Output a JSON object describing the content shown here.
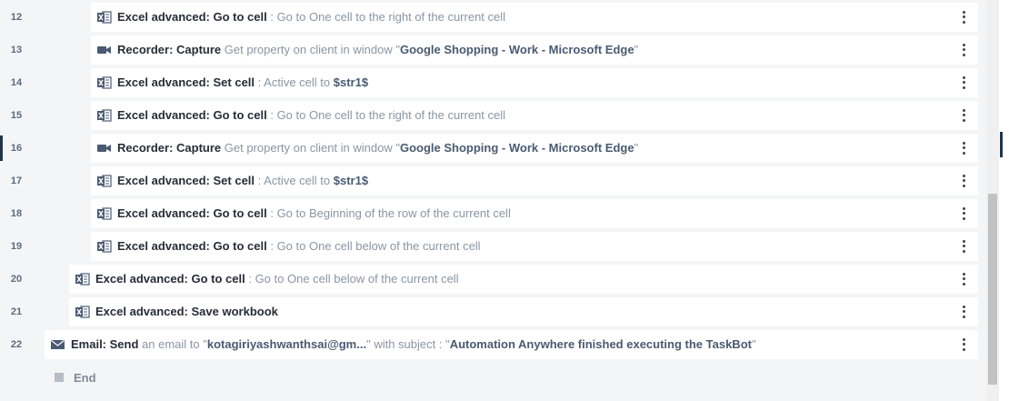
{
  "colors": {
    "excel_icon": "#4a5a72",
    "recorder_icon": "#4a5a72",
    "email_icon": "#4a5a72",
    "active_marker": "#1f3550"
  },
  "rows": [
    {
      "line": "12",
      "icon": "excel-icon",
      "cmd": "Excel advanced: Go to cell",
      "parts": [
        {
          "t": "desc",
          "v": " : Go to One cell to the right of the current cell"
        }
      ]
    },
    {
      "line": "13",
      "icon": "recorder-icon",
      "cmd": "Recorder: Capture",
      "parts": [
        {
          "t": "desc",
          "v": " Get property on client in window \""
        },
        {
          "t": "val",
          "v": "Google Shopping - Work - Microsoft Edge"
        },
        {
          "t": "desc",
          "v": "\""
        }
      ]
    },
    {
      "line": "14",
      "icon": "excel-icon",
      "cmd": "Excel advanced: Set cell",
      "parts": [
        {
          "t": "desc",
          "v": " : Active cell to "
        },
        {
          "t": "val",
          "v": "$str1$"
        }
      ]
    },
    {
      "line": "15",
      "icon": "excel-icon",
      "cmd": "Excel advanced: Go to cell",
      "parts": [
        {
          "t": "desc",
          "v": " : Go to One cell to the right of the current cell"
        }
      ]
    },
    {
      "line": "16",
      "icon": "recorder-icon",
      "cmd": "Recorder: Capture",
      "parts": [
        {
          "t": "desc",
          "v": " Get property on client in window \""
        },
        {
          "t": "val",
          "v": "Google Shopping - Work - Microsoft Edge"
        },
        {
          "t": "desc",
          "v": "\""
        }
      ],
      "active": true
    },
    {
      "line": "17",
      "icon": "excel-icon",
      "cmd": "Excel advanced: Set cell",
      "parts": [
        {
          "t": "desc",
          "v": " : Active cell to "
        },
        {
          "t": "val",
          "v": "$str1$"
        }
      ]
    },
    {
      "line": "18",
      "icon": "excel-icon",
      "cmd": "Excel advanced: Go to cell",
      "parts": [
        {
          "t": "desc",
          "v": " : Go to Beginning of the row of the current cell"
        }
      ]
    },
    {
      "line": "19",
      "icon": "excel-icon",
      "cmd": "Excel advanced: Go to cell",
      "parts": [
        {
          "t": "desc",
          "v": " : Go to One cell below of the current cell"
        }
      ]
    },
    {
      "line": "20",
      "icon": "excel-icon",
      "cmd": "Excel advanced: Go to cell",
      "parts": [
        {
          "t": "desc",
          "v": " : Go to One cell below of the current cell"
        }
      ]
    },
    {
      "line": "21",
      "icon": "excel-icon",
      "cmd": "Excel advanced: Save workbook",
      "parts": []
    },
    {
      "line": "22",
      "icon": "email-icon",
      "cmd": "Email: Send",
      "parts": [
        {
          "t": "desc",
          "v": " an email to \""
        },
        {
          "t": "val",
          "v": "kotagiriyashwanthsai@gm..."
        },
        {
          "t": "desc",
          "v": "\" with subject : \""
        },
        {
          "t": "val",
          "v": "Automation Anywhere finished executing the TaskBot"
        },
        {
          "t": "desc",
          "v": "\""
        }
      ]
    }
  ],
  "end_label": "End"
}
